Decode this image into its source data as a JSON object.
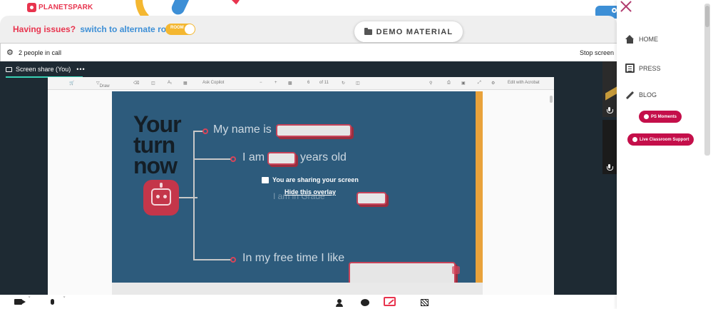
{
  "brand": {
    "logo_text": "PLANETSPARK"
  },
  "issues": {
    "prefix": "Having issues?",
    "link": "switch to alternate room",
    "toggle_label": "ROOM"
  },
  "demo_material": {
    "label": "DEMO MATERIAL"
  },
  "call": {
    "people_count": "2 people in call",
    "stop_label": "Stop screen",
    "share_tab": "Screen share (You)",
    "share_tab_menu": "•••"
  },
  "viewer_toolbar": {
    "draw": "Draw",
    "ask_copilot": "Ask Copilot",
    "page_current": "6",
    "page_total": "of 11",
    "edit": "Edit with Acrobat"
  },
  "slide": {
    "heading": [
      "Your",
      "turn",
      "now"
    ],
    "prompts": [
      "My name is",
      "I am",
      "years old",
      "I am in Grade",
      "In my free time I like"
    ]
  },
  "overlay": {
    "title": "You are sharing your screen",
    "hide_link": "Hide this overlay"
  },
  "sidemenu": {
    "items": [
      "HOME",
      "PRESS",
      "BLOG"
    ],
    "moments_pill": "PS Moments",
    "support_pill": "Live Classroom Support"
  },
  "colors": {
    "brand_red": "#e8344e",
    "brand_blue": "#3d8fd6",
    "brand_yellow": "#f4b731",
    "call_bg": "#1e2a33",
    "slide_bg": "#2d5b7c",
    "pill": "#c40f4a",
    "accent_teal": "#39d0b4"
  }
}
